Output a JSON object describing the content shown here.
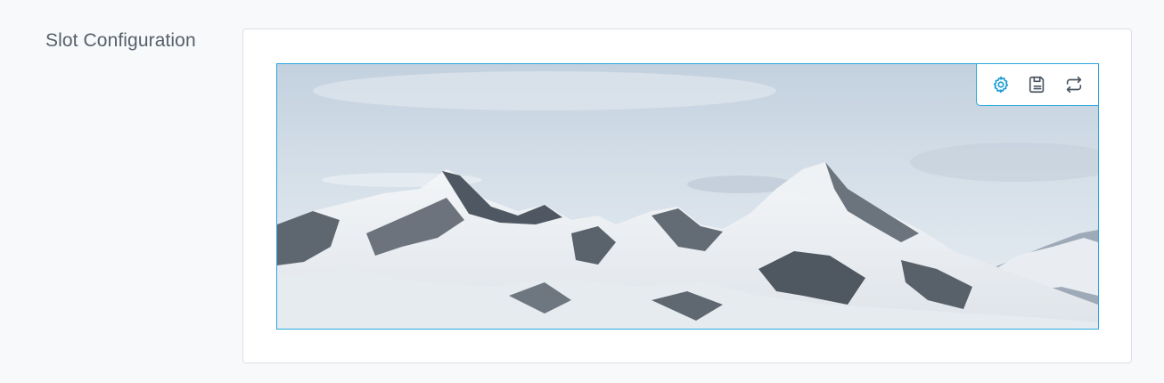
{
  "section": {
    "label": "Slot Configuration"
  },
  "slot": {
    "image": "snowy-mountain-range-photo",
    "toolbar": {
      "buttons": [
        {
          "icon": "gear-icon",
          "color": "#1a9bd7"
        },
        {
          "icon": "save-icon",
          "color": "#4a5560"
        },
        {
          "icon": "swap-icon",
          "color": "#4a5560"
        }
      ]
    },
    "accent_color": "#2aa7dd"
  }
}
